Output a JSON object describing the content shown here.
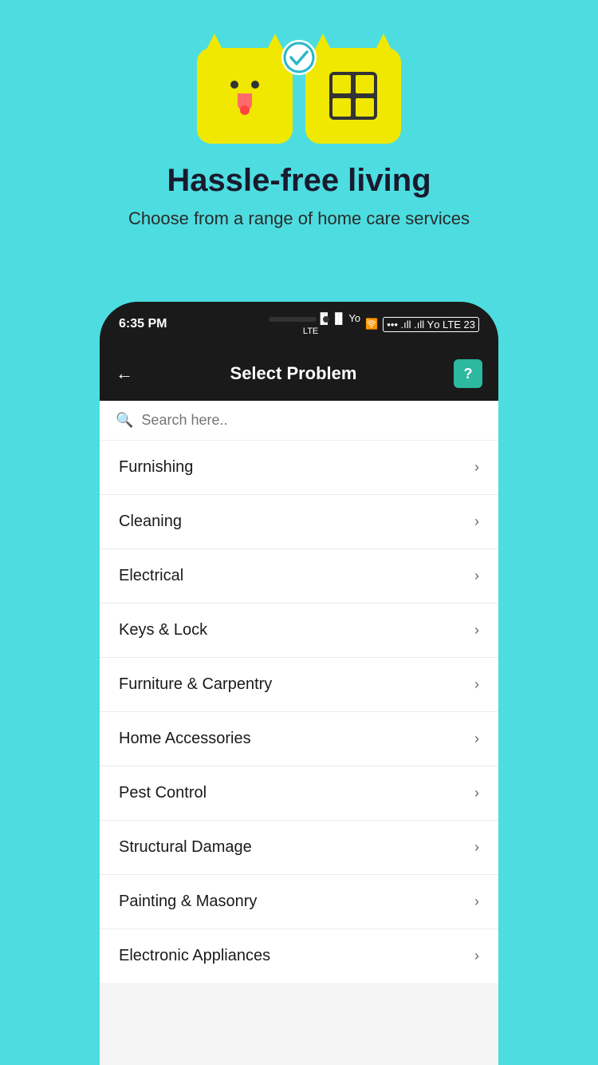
{
  "background_color": "#4DDDE0",
  "top": {
    "headline": "Hassle-free living",
    "subheadline": "Choose from a range of home care services"
  },
  "phone": {
    "status_time": "6:35 PM",
    "status_icons": "••• .ıll .ıll Yо LTE 23",
    "app_header": {
      "title": "Select Problem",
      "back_icon": "←",
      "help_icon": "?"
    },
    "search": {
      "placeholder": "Search here.."
    },
    "menu_items": [
      {
        "label": "Furnishing"
      },
      {
        "label": "Cleaning"
      },
      {
        "label": "Electrical"
      },
      {
        "label": "Keys & Lock"
      },
      {
        "label": "Furniture & Carpentry"
      },
      {
        "label": "Home Accessories"
      },
      {
        "label": "Pest Control"
      },
      {
        "label": "Structural Damage"
      },
      {
        "label": "Painting & Masonry"
      },
      {
        "label": "Electronic Appliances"
      }
    ]
  }
}
